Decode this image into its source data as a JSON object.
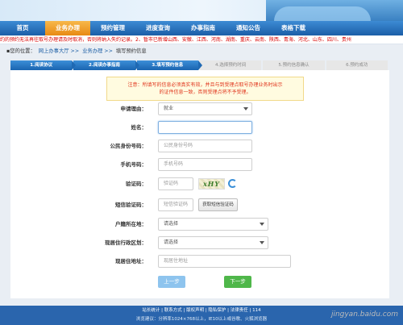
{
  "nav": {
    "items": [
      "首页",
      "业务办理",
      "预约管理",
      "进度查询",
      "办事指南",
      "通知公告",
      "表格下载"
    ],
    "active": 1
  },
  "notice_text": "约的预约无法再往取号办理请及时取消，否则将纳入失约记录。2、暂市已新增山西、安徽、江西、河南、湖南、重庆、云南、陕西、青海、河北、山东、四川、贵州",
  "breadcrumb": {
    "label": "▪您的位置：",
    "items": [
      "网上办事大厅 >>",
      "业务办理 >>",
      "填写预约信息"
    ]
  },
  "steps": [
    {
      "label": "1.阅读协议",
      "done": true
    },
    {
      "label": "2.阅读办事指南",
      "done": true
    },
    {
      "label": "3.填写预约信息",
      "done": true
    },
    {
      "label": "4.选择预约时间",
      "done": false
    },
    {
      "label": "5.预约信息确认",
      "done": false
    },
    {
      "label": "6.预约成功",
      "done": false
    }
  ],
  "tip": {
    "line1": "注意：所填写的信息必须真实有效，并且与到受理点取号办理业务时出示",
    "line2": "的证件信息一致，否则受理点将不予受理。"
  },
  "form": {
    "reason_label": "申请理由：",
    "reason_value": "就业",
    "name_label": "姓名：",
    "name_value": "",
    "id_label": "公民身份号码：",
    "id_placeholder": "公民身份号码",
    "phone_label": "手机号码：",
    "phone_placeholder": "手机号码",
    "captcha_label": "验证码：",
    "captcha_placeholder": "验证码",
    "captcha_text": "xHY",
    "sms_label": "短信验证码：",
    "sms_placeholder": "短信验证码",
    "sms_button": "获取短信验证码",
    "hukou_label": "户籍所在地：",
    "hukou_value": "请选择",
    "region_label": "现居住行政区划：",
    "region_value": "请选择",
    "address_label": "现居住地址：",
    "address_placeholder": "现居住地址"
  },
  "buttons": {
    "prev": "上一步",
    "next": "下一步"
  },
  "footer": {
    "line1": "站长统计 | 联系方式 | 版权声明 | 隐私保护 | 法律责任 | 114",
    "line2": "浏览建议：分辨率1024×768以上，IE10以上或谷歌、火狐浏览器"
  },
  "watermark": "jingyan.baidu.com"
}
